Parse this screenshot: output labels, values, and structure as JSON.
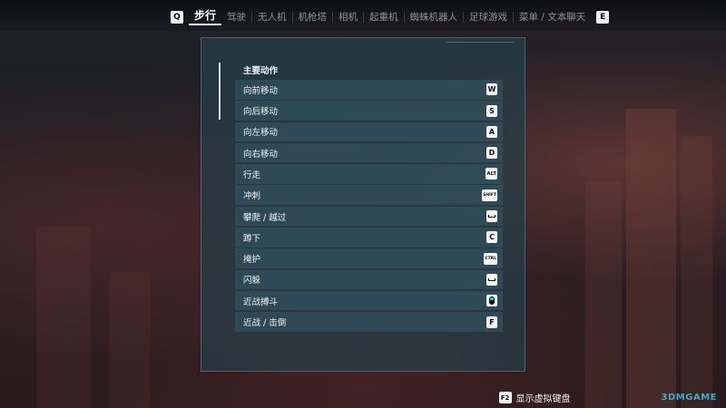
{
  "top_bar": {
    "left_key": "Q",
    "right_key": "E",
    "tabs": [
      {
        "label": "步行",
        "active": true
      },
      {
        "label": "驾驶"
      },
      {
        "label": "无人机"
      },
      {
        "label": "机枪塔"
      },
      {
        "label": "相机"
      },
      {
        "label": "起重机"
      },
      {
        "label": "蜘蛛机器人"
      },
      {
        "label": "足球游戏"
      },
      {
        "label": "菜单 / 文本聊天"
      }
    ]
  },
  "panel": {
    "section_title": "主要动作",
    "rows": [
      {
        "label": "向前移动",
        "key": "W",
        "key_icon": "w-key"
      },
      {
        "label": "向后移动",
        "key": "S",
        "key_icon": "s-key"
      },
      {
        "label": "向左移动",
        "key": "A",
        "key_icon": "a-key"
      },
      {
        "label": "向右移动",
        "key": "D",
        "key_icon": "d-key"
      },
      {
        "label": "行走",
        "key": "ALT",
        "key_icon": "alt-key"
      },
      {
        "label": "冲刺",
        "key": "SHIFT",
        "key_icon": "shift-key"
      },
      {
        "label": "攀爬 / 越过",
        "key": "",
        "key_icon": "space-key-icon"
      },
      {
        "label": "蹲下",
        "key": "C",
        "key_icon": "c-key"
      },
      {
        "label": "掩护",
        "key": "CTRL",
        "key_icon": "ctrl-key"
      },
      {
        "label": "闪躲",
        "key": "",
        "key_icon": "space-key-icon"
      },
      {
        "label": "近战搏斗",
        "key": "",
        "key_icon": "mouse-icon"
      },
      {
        "label": "近战 / 击倒",
        "key": "F",
        "key_icon": "f-key"
      }
    ]
  },
  "bottom": {
    "hint_key": "F2",
    "hint_label": "显示虚拟键盘",
    "watermark": "3DMGAME"
  },
  "colors": {
    "panel_bg": "#263e48",
    "row_bg": "#304e5a",
    "keycap_bg": "#f4f4f4",
    "accent_text": "#ffffff"
  }
}
